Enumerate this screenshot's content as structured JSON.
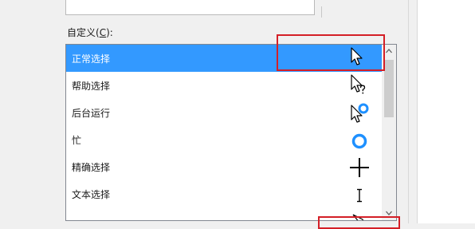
{
  "custom_label": {
    "prefix": "自定义(",
    "key": "C",
    "suffix": "):"
  },
  "cursor_list": {
    "items": [
      {
        "label": "正常选择",
        "cursor": "normal-select",
        "selected": true
      },
      {
        "label": "帮助选择",
        "cursor": "help-select",
        "selected": false
      },
      {
        "label": "后台运行",
        "cursor": "working-in-background",
        "selected": false
      },
      {
        "label": "忙",
        "cursor": "busy",
        "selected": false
      },
      {
        "label": "精确选择",
        "cursor": "precision-select",
        "selected": false
      },
      {
        "label": "文本选择",
        "cursor": "text-select",
        "selected": false
      }
    ]
  },
  "colors": {
    "selection": "#3399ff",
    "annotation": "#d41f27",
    "busy_ring": "#1e90ff"
  }
}
